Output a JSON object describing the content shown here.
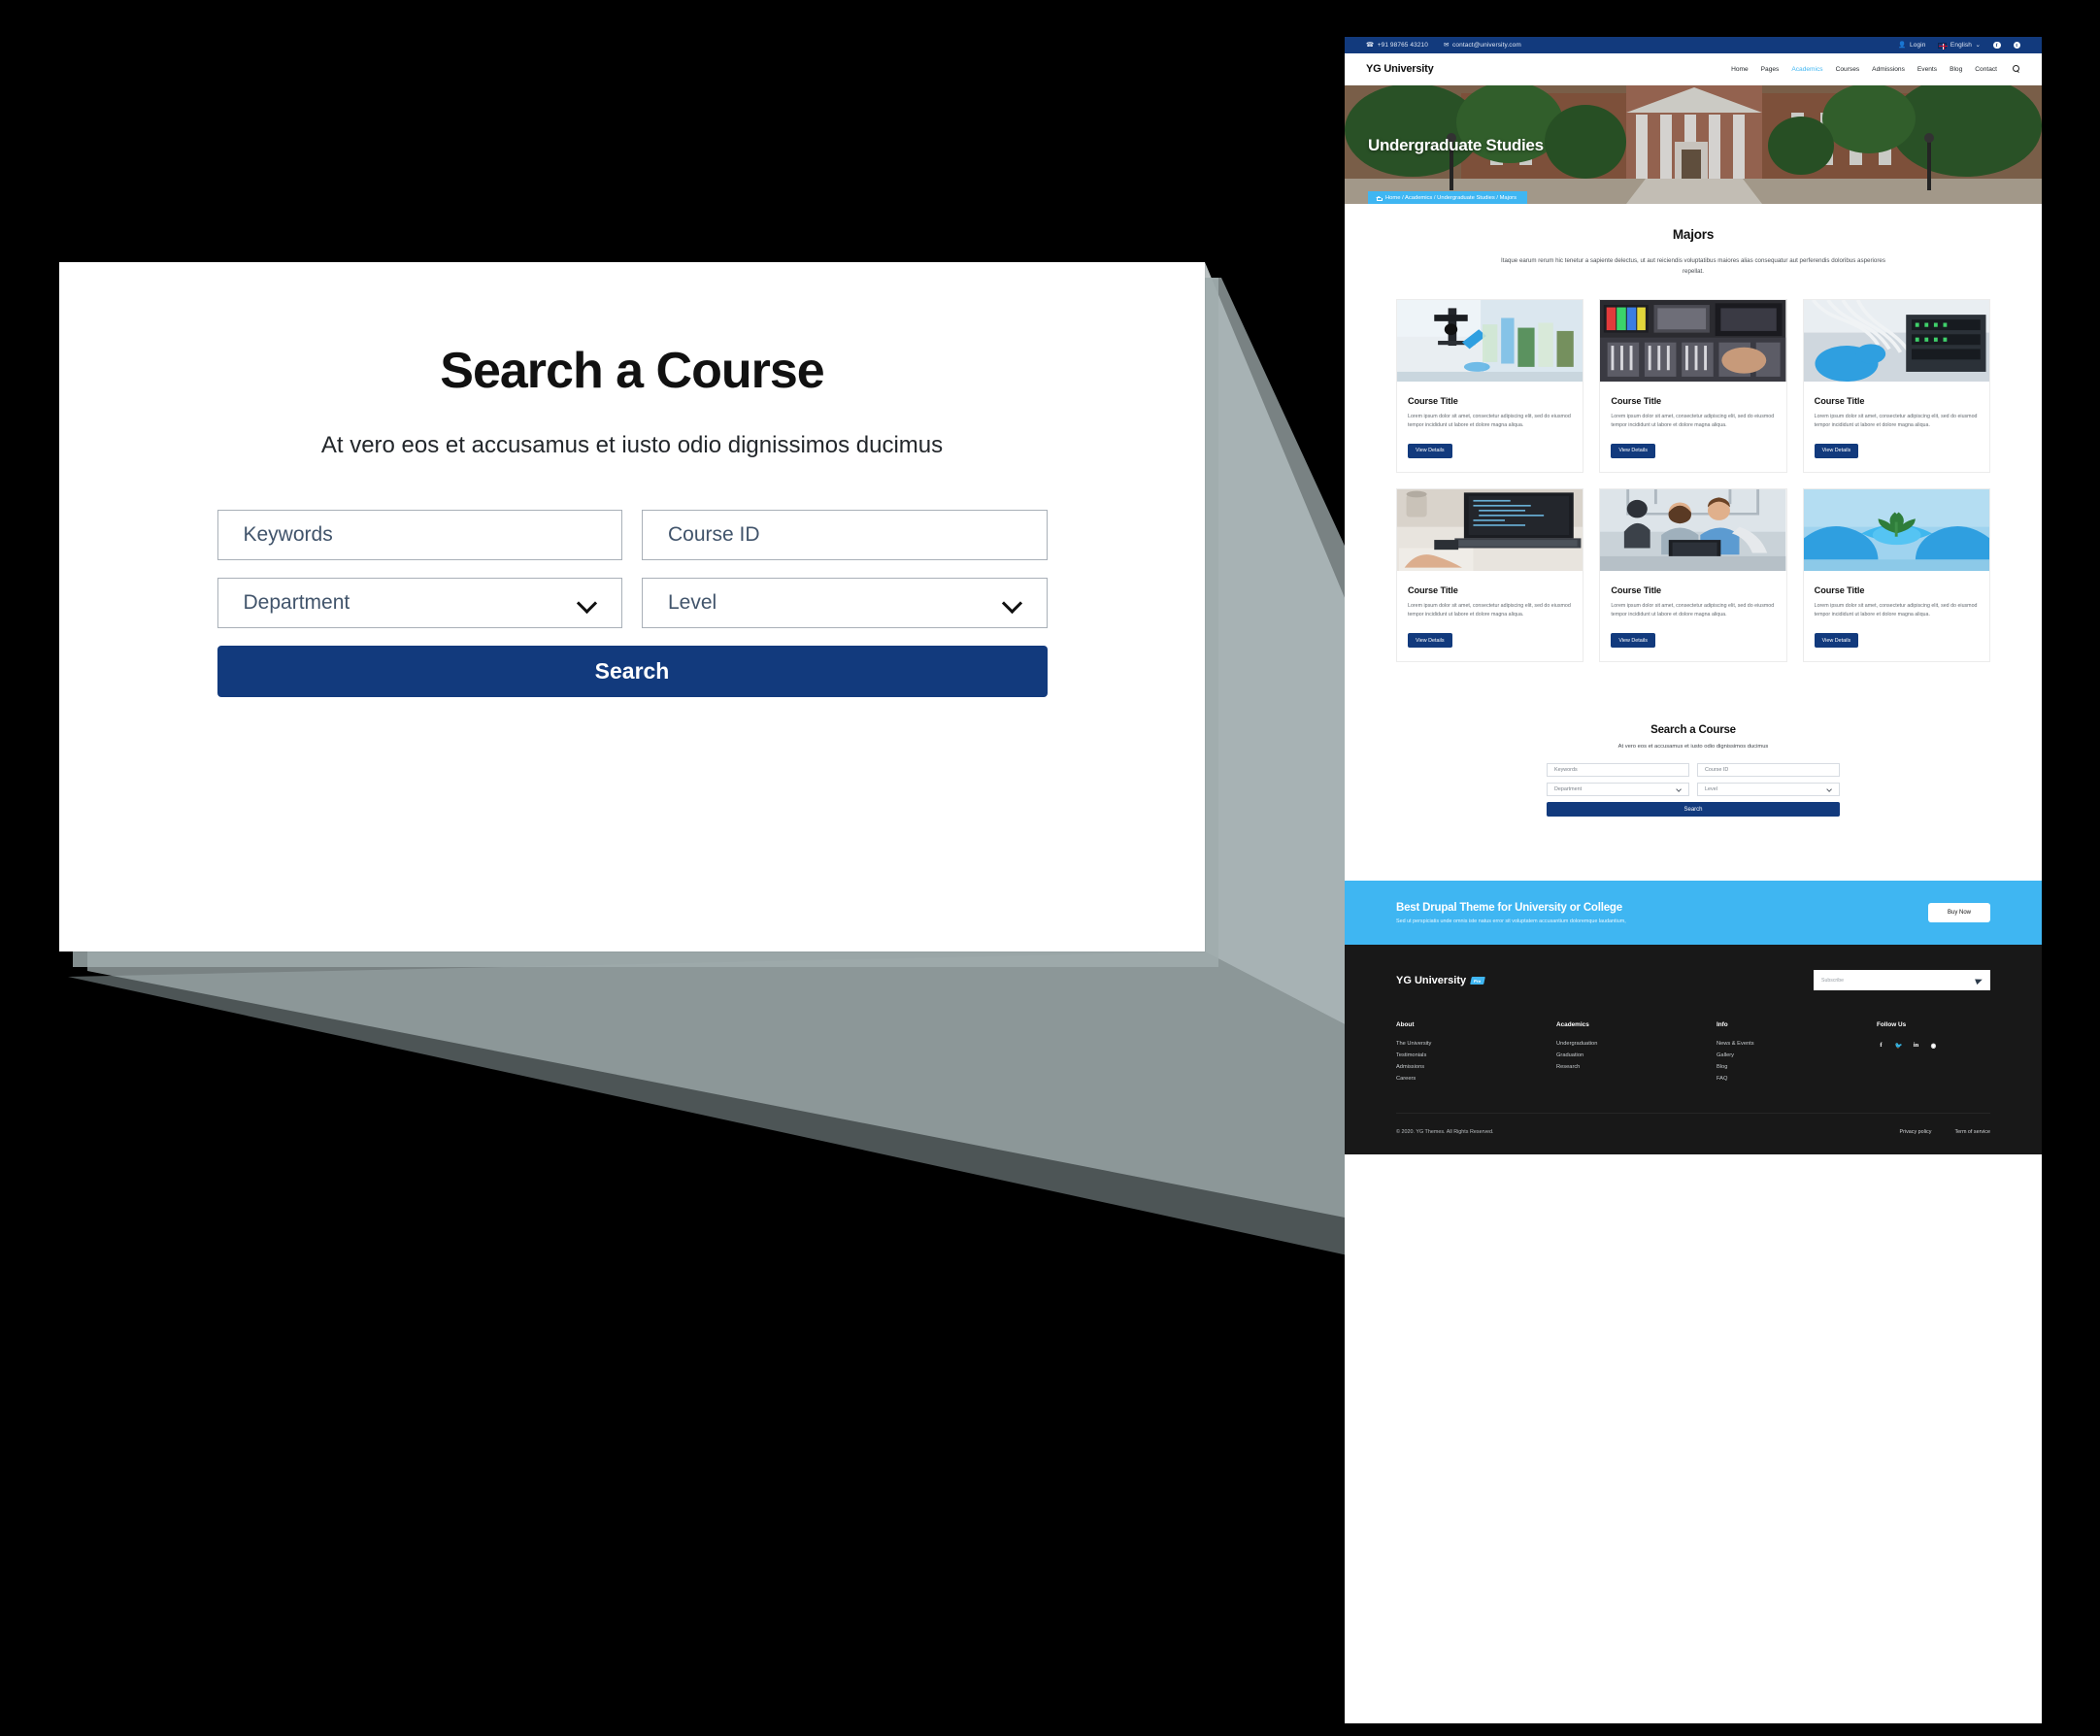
{
  "topbar": {
    "phone": "+91 98765 43210",
    "email": "contact@university.com",
    "login": "Login",
    "language": "English",
    "phone_icon": "phone-icon",
    "mail_icon": "mail-icon",
    "user_icon": "user-icon",
    "flag_icon": "uk-flag-icon",
    "chevron_icon": "chevron-down-icon",
    "facebook": "f",
    "twitter": "t",
    "bg": "#123a7d"
  },
  "nav": {
    "brand": "YG University",
    "items": [
      {
        "label": "Home",
        "active": false
      },
      {
        "label": "Pages",
        "active": false
      },
      {
        "label": "Academics",
        "active": true
      },
      {
        "label": "Courses",
        "active": false
      },
      {
        "label": "Admissions",
        "active": false
      },
      {
        "label": "Events",
        "active": false
      },
      {
        "label": "Blog",
        "active": false
      },
      {
        "label": "Contact",
        "active": false
      }
    ],
    "search_icon": "search-icon",
    "accent": "#3fb6f2"
  },
  "hero": {
    "title": "Undergraduate Studies",
    "breadcrumb": "Home / Academics / Undergraduate Studies / Majors",
    "home_icon": "home-icon",
    "breadcrumb_bg": "#3fb6f2"
  },
  "majors": {
    "heading": "Majors",
    "description": "Itaque earum rerum hic tenetur a sapiente delectus, ut aut reiciendis voluptatibus maiores alias consequatur aut perferendis doloribus asperiores repellat.",
    "cards": [
      {
        "title": "Course Title",
        "text": "Lorem ipsum dolor sit amet, consectetur adipiscing elit, sed do eiusmod tempor incididunt ut labore et dolore magna aliqua.",
        "button": "View Details",
        "image": "lab-microscope-photo"
      },
      {
        "title": "Course Title",
        "text": "Lorem ipsum dolor sit amet, consectetur adipiscing elit, sed do eiusmod tempor incididunt ut labore et dolore magna aliqua.",
        "button": "View Details",
        "image": "broadcast-console-photo"
      },
      {
        "title": "Course Title",
        "text": "Lorem ipsum dolor sit amet, consectetur adipiscing elit, sed do eiusmod tempor incididunt ut labore et dolore magna aliqua.",
        "button": "View Details",
        "image": "network-cables-photo"
      },
      {
        "title": "Course Title",
        "text": "Lorem ipsum dolor sit amet, consectetur adipiscing elit, sed do eiusmod tempor incididunt ut labore et dolore magna aliqua.",
        "button": "View Details",
        "image": "laptop-coding-photo"
      },
      {
        "title": "Course Title",
        "text": "Lorem ipsum dolor sit amet, consectetur adipiscing elit, sed do eiusmod tempor incididunt ut labore et dolore magna aliqua.",
        "button": "View Details",
        "image": "students-robotics-photo"
      },
      {
        "title": "Course Title",
        "text": "Lorem ipsum dolor sit amet, consectetur adipiscing elit, sed do eiusmod tempor incididunt ut labore et dolore magna aliqua.",
        "button": "View Details",
        "image": "gloved-hands-plant-photo"
      }
    ]
  },
  "search_section": {
    "heading": "Search a Course",
    "subheading": "At vero eos et accusamus et iusto odio dignissimos ducimus",
    "keywords_placeholder": "Keywords",
    "courseid_placeholder": "Course ID",
    "department_value": "Department",
    "level_value": "Level",
    "search_button": "Search",
    "chevron_icon": "chevron-down-icon",
    "button_color": "#123a7d"
  },
  "cta": {
    "title": "Best Drupal Theme for University or College",
    "text": "Sed ut perspiciatis unde omnis iste natus error sit voluptatem accusantium doloremque laudantium,",
    "button": "Buy Now",
    "bg": "#3fb6f2"
  },
  "footer": {
    "brand": "YG University",
    "badge": "Pro",
    "subscribe_placeholder": "Subscribe",
    "send_icon": "send-icon",
    "columns": [
      {
        "title": "About",
        "links": [
          "The University",
          "Testimonials",
          "Admissions",
          "Careers"
        ]
      },
      {
        "title": "Academics",
        "links": [
          "Undergraduation",
          "Graduation",
          "Research"
        ]
      },
      {
        "title": "Info",
        "links": [
          "News & Events",
          "Gallery",
          "Blog",
          "FAQ"
        ]
      }
    ],
    "follow_title": "Follow Us",
    "socials": [
      "facebook-icon",
      "twitter-icon",
      "linkedin-icon",
      "instagram-icon"
    ],
    "copyright": "© 2020. YG Themes. All Rights Reserved.",
    "privacy": "Privacy policy",
    "terms": "Term of service",
    "bg": "#181818"
  }
}
